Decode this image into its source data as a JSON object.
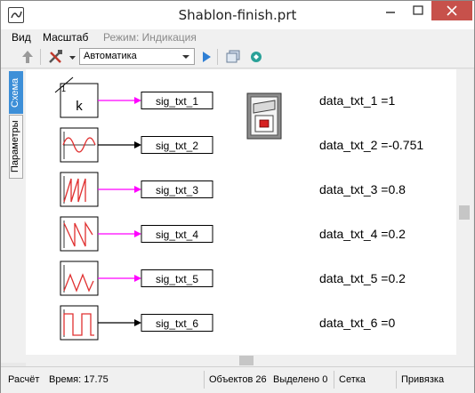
{
  "window": {
    "title": "Shablon-finish.prt"
  },
  "menu": {
    "items": [
      "Вид",
      "Масштаб",
      "Режим: Индикация"
    ]
  },
  "toolbar": {
    "mode_select": "Автоматика"
  },
  "tabs": {
    "schema": "Схема",
    "params": "Параметры"
  },
  "diagram": {
    "blocks": [
      {
        "type": "constant",
        "label": "k"
      },
      {
        "type": "sine"
      },
      {
        "type": "sawtooth"
      },
      {
        "type": "sawtooth-falling"
      },
      {
        "type": "triangle"
      },
      {
        "type": "square"
      }
    ],
    "signals": [
      "sig_txt_1",
      "sig_txt_2",
      "sig_txt_3",
      "sig_txt_4",
      "sig_txt_5",
      "sig_txt_6"
    ],
    "data_texts": [
      "data_txt_1 =1",
      "data_txt_2 =-0.751",
      "data_txt_3 =0.8",
      "data_txt_4 =0.2",
      "data_txt_5 =0.2",
      "data_txt_6 =0"
    ],
    "wire_colors": [
      "#ff00ff",
      "#000000",
      "#ff00ff",
      "#ff00ff",
      "#ff00ff",
      "#000000"
    ]
  },
  "status": {
    "mode": "Расчёт",
    "time": "Время: 17.75",
    "objects": "Объектов 26",
    "selected": "Выделено 0",
    "grid": "Сетка",
    "snap": "Привязка"
  }
}
